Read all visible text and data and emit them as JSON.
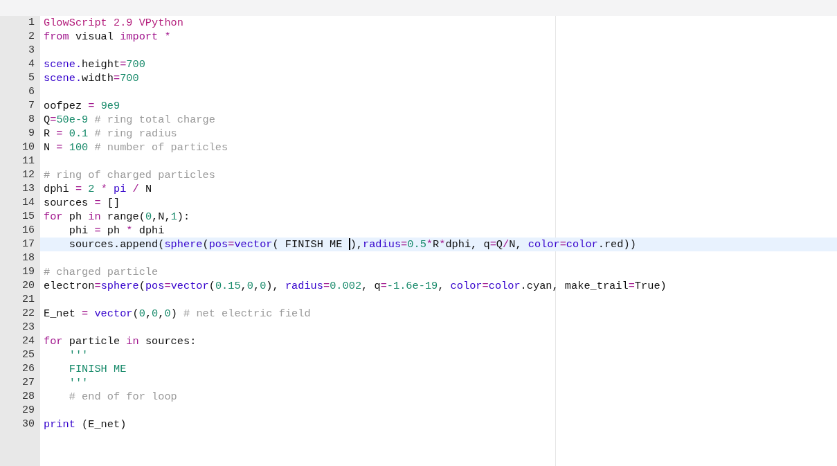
{
  "editor": {
    "lines": [
      {
        "number": "1",
        "active": false,
        "tokens": [
          {
            "kind": "header",
            "text": "GlowScript 2.9 VPython"
          }
        ]
      },
      {
        "number": "2",
        "active": false,
        "tokens": [
          {
            "kind": "keyword",
            "text": "from"
          },
          {
            "kind": "plain",
            "text": " visual "
          },
          {
            "kind": "keyword",
            "text": "import"
          },
          {
            "kind": "operator",
            "text": " *"
          }
        ]
      },
      {
        "number": "3",
        "active": false
      },
      {
        "number": "4",
        "active": false,
        "tokens": [
          {
            "kind": "builtin",
            "text": "scene."
          },
          {
            "kind": "plain",
            "text": "height"
          },
          {
            "kind": "operator",
            "text": "="
          },
          {
            "kind": "number",
            "text": "700"
          }
        ]
      },
      {
        "number": "5",
        "active": false,
        "tokens": [
          {
            "kind": "builtin",
            "text": "scene."
          },
          {
            "kind": "plain",
            "text": "width"
          },
          {
            "kind": "operator",
            "text": "="
          },
          {
            "kind": "number",
            "text": "700"
          }
        ]
      },
      {
        "number": "6",
        "active": false
      },
      {
        "number": "7",
        "active": false,
        "tokens": [
          {
            "kind": "plain",
            "text": "oofpez "
          },
          {
            "kind": "operator",
            "text": "="
          },
          {
            "kind": "number",
            "text": " 9e9"
          }
        ]
      },
      {
        "number": "8",
        "active": false,
        "tokens": [
          {
            "kind": "plain",
            "text": "Q"
          },
          {
            "kind": "operator",
            "text": "="
          },
          {
            "kind": "number",
            "text": "50e-9"
          },
          {
            "kind": "comment",
            "text": " # ring total charge"
          }
        ]
      },
      {
        "number": "9",
        "active": false,
        "tokens": [
          {
            "kind": "plain",
            "text": "R "
          },
          {
            "kind": "operator",
            "text": "="
          },
          {
            "kind": "number",
            "text": " 0.1"
          },
          {
            "kind": "comment",
            "text": " # ring radius"
          }
        ]
      },
      {
        "number": "10",
        "active": false,
        "tokens": [
          {
            "kind": "plain",
            "text": "N "
          },
          {
            "kind": "operator",
            "text": "="
          },
          {
            "kind": "number",
            "text": " 100"
          },
          {
            "kind": "comment",
            "text": " # number of particles"
          }
        ]
      },
      {
        "number": "11",
        "active": false
      },
      {
        "number": "12",
        "active": false,
        "tokens": [
          {
            "kind": "comment",
            "text": "# ring of charged particles"
          }
        ]
      },
      {
        "number": "13",
        "active": false,
        "tokens": [
          {
            "kind": "plain",
            "text": "dphi "
          },
          {
            "kind": "operator",
            "text": "="
          },
          {
            "kind": "number",
            "text": " 2"
          },
          {
            "kind": "operator",
            "text": " *"
          },
          {
            "kind": "builtin",
            "text": " pi"
          },
          {
            "kind": "operator",
            "text": " /"
          },
          {
            "kind": "plain",
            "text": " N"
          }
        ]
      },
      {
        "number": "14",
        "active": false,
        "tokens": [
          {
            "kind": "plain",
            "text": "sources "
          },
          {
            "kind": "operator",
            "text": "="
          },
          {
            "kind": "plain",
            "text": " []"
          }
        ]
      },
      {
        "number": "15",
        "active": false,
        "tokens": [
          {
            "kind": "keyword",
            "text": "for"
          },
          {
            "kind": "plain",
            "text": " ph "
          },
          {
            "kind": "keyword",
            "text": "in"
          },
          {
            "kind": "plain",
            "text": " range("
          },
          {
            "kind": "number",
            "text": "0"
          },
          {
            "kind": "plain",
            "text": ",N,"
          },
          {
            "kind": "number",
            "text": "1"
          },
          {
            "kind": "plain",
            "text": "):"
          }
        ]
      },
      {
        "number": "16",
        "active": false,
        "tokens": [
          {
            "kind": "plain",
            "text": "    phi "
          },
          {
            "kind": "operator",
            "text": "="
          },
          {
            "kind": "plain",
            "text": " ph "
          },
          {
            "kind": "operator",
            "text": "*"
          },
          {
            "kind": "plain",
            "text": " dphi"
          }
        ]
      },
      {
        "number": "17",
        "active": true,
        "tokens": [
          {
            "kind": "plain",
            "text": "    sources.append("
          },
          {
            "kind": "builtin",
            "text": "sphere"
          },
          {
            "kind": "plain",
            "text": "("
          },
          {
            "kind": "builtin",
            "text": "pos"
          },
          {
            "kind": "operator",
            "text": "="
          },
          {
            "kind": "builtin",
            "text": "vector"
          },
          {
            "kind": "plain",
            "text": "( FINISH ME "
          },
          {
            "kind": "cursor"
          },
          {
            "kind": "plain",
            "text": "),"
          },
          {
            "kind": "builtin",
            "text": "radius"
          },
          {
            "kind": "operator",
            "text": "="
          },
          {
            "kind": "number",
            "text": "0.5"
          },
          {
            "kind": "operator",
            "text": "*"
          },
          {
            "kind": "plain",
            "text": "R"
          },
          {
            "kind": "operator",
            "text": "*"
          },
          {
            "kind": "plain",
            "text": "dphi, q"
          },
          {
            "kind": "operator",
            "text": "="
          },
          {
            "kind": "plain",
            "text": "Q"
          },
          {
            "kind": "operator",
            "text": "/"
          },
          {
            "kind": "plain",
            "text": "N, "
          },
          {
            "kind": "builtin",
            "text": "color"
          },
          {
            "kind": "operator",
            "text": "="
          },
          {
            "kind": "builtin",
            "text": "color"
          },
          {
            "kind": "plain",
            "text": ".red))"
          }
        ]
      },
      {
        "number": "18",
        "active": false
      },
      {
        "number": "19",
        "active": false,
        "tokens": [
          {
            "kind": "comment",
            "text": "# charged particle"
          }
        ]
      },
      {
        "number": "20",
        "active": false,
        "tokens": [
          {
            "kind": "plain",
            "text": "electron"
          },
          {
            "kind": "operator",
            "text": "="
          },
          {
            "kind": "builtin",
            "text": "sphere"
          },
          {
            "kind": "plain",
            "text": "("
          },
          {
            "kind": "builtin",
            "text": "pos"
          },
          {
            "kind": "operator",
            "text": "="
          },
          {
            "kind": "builtin",
            "text": "vector"
          },
          {
            "kind": "plain",
            "text": "("
          },
          {
            "kind": "number",
            "text": "0.15"
          },
          {
            "kind": "plain",
            "text": ","
          },
          {
            "kind": "number",
            "text": "0"
          },
          {
            "kind": "plain",
            "text": ","
          },
          {
            "kind": "number",
            "text": "0"
          },
          {
            "kind": "plain",
            "text": "), "
          },
          {
            "kind": "builtin",
            "text": "radius"
          },
          {
            "kind": "operator",
            "text": "="
          },
          {
            "kind": "number",
            "text": "0.002"
          },
          {
            "kind": "plain",
            "text": ", q"
          },
          {
            "kind": "operator",
            "text": "="
          },
          {
            "kind": "number",
            "text": "-1.6e-19"
          },
          {
            "kind": "plain",
            "text": ", "
          },
          {
            "kind": "builtin",
            "text": "color"
          },
          {
            "kind": "operator",
            "text": "="
          },
          {
            "kind": "builtin",
            "text": "color"
          },
          {
            "kind": "plain",
            "text": ".cyan, make_trail"
          },
          {
            "kind": "operator",
            "text": "="
          },
          {
            "kind": "plain",
            "text": "True)"
          }
        ]
      },
      {
        "number": "21",
        "active": false
      },
      {
        "number": "22",
        "active": false,
        "tokens": [
          {
            "kind": "plain",
            "text": "E_net "
          },
          {
            "kind": "operator",
            "text": "="
          },
          {
            "kind": "builtin",
            "text": " vector"
          },
          {
            "kind": "plain",
            "text": "("
          },
          {
            "kind": "number",
            "text": "0"
          },
          {
            "kind": "plain",
            "text": ","
          },
          {
            "kind": "number",
            "text": "0"
          },
          {
            "kind": "plain",
            "text": ","
          },
          {
            "kind": "number",
            "text": "0"
          },
          {
            "kind": "plain",
            "text": ")"
          },
          {
            "kind": "comment",
            "text": " # net electric field"
          }
        ]
      },
      {
        "number": "23",
        "active": false
      },
      {
        "number": "24",
        "active": false,
        "tokens": [
          {
            "kind": "keyword",
            "text": "for"
          },
          {
            "kind": "plain",
            "text": " particle "
          },
          {
            "kind": "keyword",
            "text": "in"
          },
          {
            "kind": "plain",
            "text": " sources:"
          }
        ]
      },
      {
        "number": "25",
        "active": false,
        "tokens": [
          {
            "kind": "string",
            "text": "    '''"
          }
        ]
      },
      {
        "number": "26",
        "active": false,
        "tokens": [
          {
            "kind": "string",
            "text": "    FINISH ME"
          }
        ]
      },
      {
        "number": "27",
        "active": false,
        "tokens": [
          {
            "kind": "string",
            "text": "    '''"
          }
        ]
      },
      {
        "number": "28",
        "active": false,
        "tokens": [
          {
            "kind": "comment",
            "text": "    # end of for loop"
          }
        ]
      },
      {
        "number": "29",
        "active": false
      },
      {
        "number": "30",
        "active": false,
        "tokens": [
          {
            "kind": "builtin",
            "text": "print"
          },
          {
            "kind": "plain",
            "text": " (E_net)"
          }
        ]
      }
    ]
  }
}
